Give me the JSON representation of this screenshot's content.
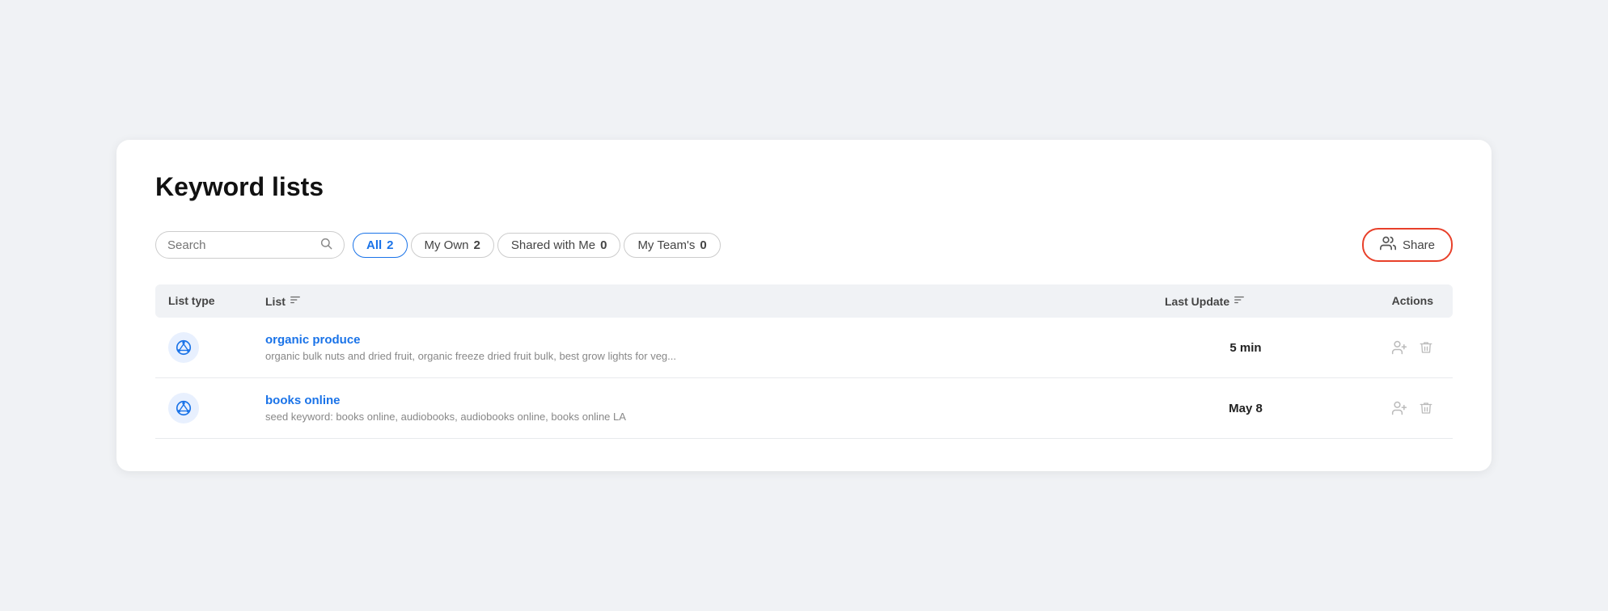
{
  "page": {
    "title": "Keyword lists"
  },
  "toolbar": {
    "search_placeholder": "Search",
    "share_label": "Share"
  },
  "filter_tabs": [
    {
      "id": "all",
      "label": "All",
      "count": "2",
      "active": true
    },
    {
      "id": "my_own",
      "label": "My Own",
      "count": "2",
      "active": false
    },
    {
      "id": "shared_with_me",
      "label": "Shared with Me",
      "count": "0",
      "active": false
    },
    {
      "id": "my_teams",
      "label": "My Team's",
      "count": "0",
      "active": false
    }
  ],
  "table": {
    "headers": {
      "list_type": "List type",
      "list": "List",
      "last_update": "Last Update",
      "actions": "Actions"
    },
    "rows": [
      {
        "id": "organic-produce",
        "name": "organic produce",
        "description": "organic bulk nuts and dried fruit, organic freeze dried fruit bulk, best grow lights for veg...",
        "last_update": "5 min"
      },
      {
        "id": "books-online",
        "name": "books online",
        "description": "seed keyword: books online, audiobooks, audiobooks online, books online LA",
        "last_update": "May 8"
      }
    ]
  },
  "icons": {
    "search": "🔍",
    "share_people": "👥",
    "add_person": "🧑+",
    "trash": "🗑"
  }
}
